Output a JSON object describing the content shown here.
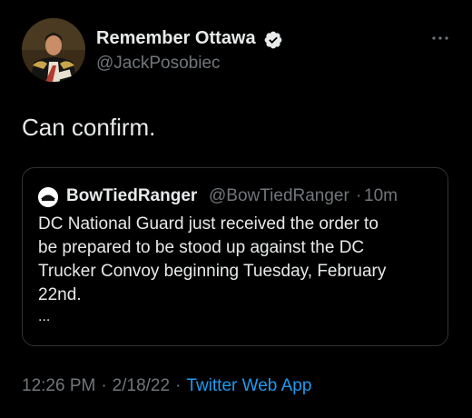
{
  "author": {
    "display_name": "Remember Ottawa",
    "handle": "@JackPosobiec",
    "verified": true,
    "avatar_icon": "portrait-avatar"
  },
  "tweet": {
    "text": "Can confirm."
  },
  "quoted_tweet": {
    "author_name": "BowTiedRanger",
    "author_handle": "@BowTiedRanger",
    "separator": "·",
    "time": "10m",
    "body_lines": [
      "DC National Guard just received the order to",
      "be prepared to be stood up against the DC",
      "Trucker Convoy beginning Tuesday, February",
      "22nd."
    ],
    "ellipsis": "..."
  },
  "meta": {
    "time": "12:26 PM",
    "sep1": "·",
    "date": "2/18/22",
    "sep2": "·",
    "source": "Twitter Web App"
  },
  "colors": {
    "background": "#000000",
    "text": "#e7e9ea",
    "secondary": "#71767b",
    "accent": "#1d9bf0",
    "border": "#2f3336"
  },
  "icons": [
    "more-icon",
    "verified-badge-icon"
  ]
}
